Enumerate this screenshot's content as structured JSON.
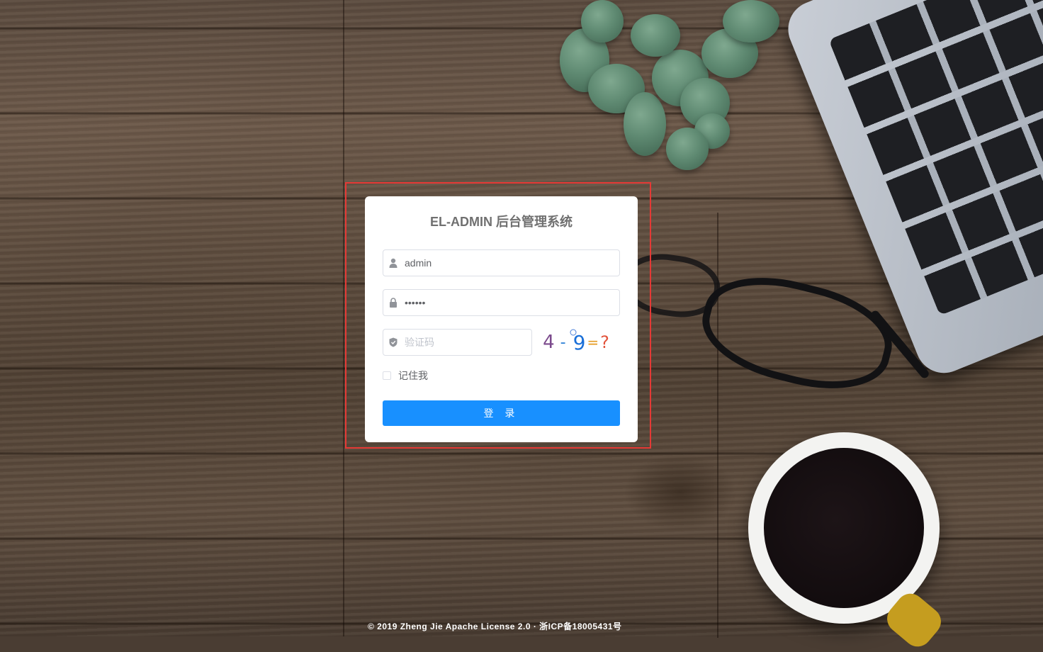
{
  "login": {
    "title": "EL-ADMIN 后台管理系统",
    "username_value": "admin",
    "password_value": "••••••",
    "captcha_placeholder": "验证码",
    "captcha_chars": [
      "4",
      "-",
      "9",
      "=",
      "?"
    ],
    "remember_label": "记住我",
    "remember_checked": false,
    "login_button_label": "登 录"
  },
  "icons": {
    "username": "user-icon",
    "password": "lock-icon",
    "captcha": "shield-icon"
  },
  "colors": {
    "primary_button": "#1890ff",
    "highlight_border": "#e53935",
    "title": "#707070"
  },
  "footer": {
    "text": "© 2019 Zheng Jie Apache License 2.0 · 浙ICP备18005431号"
  }
}
